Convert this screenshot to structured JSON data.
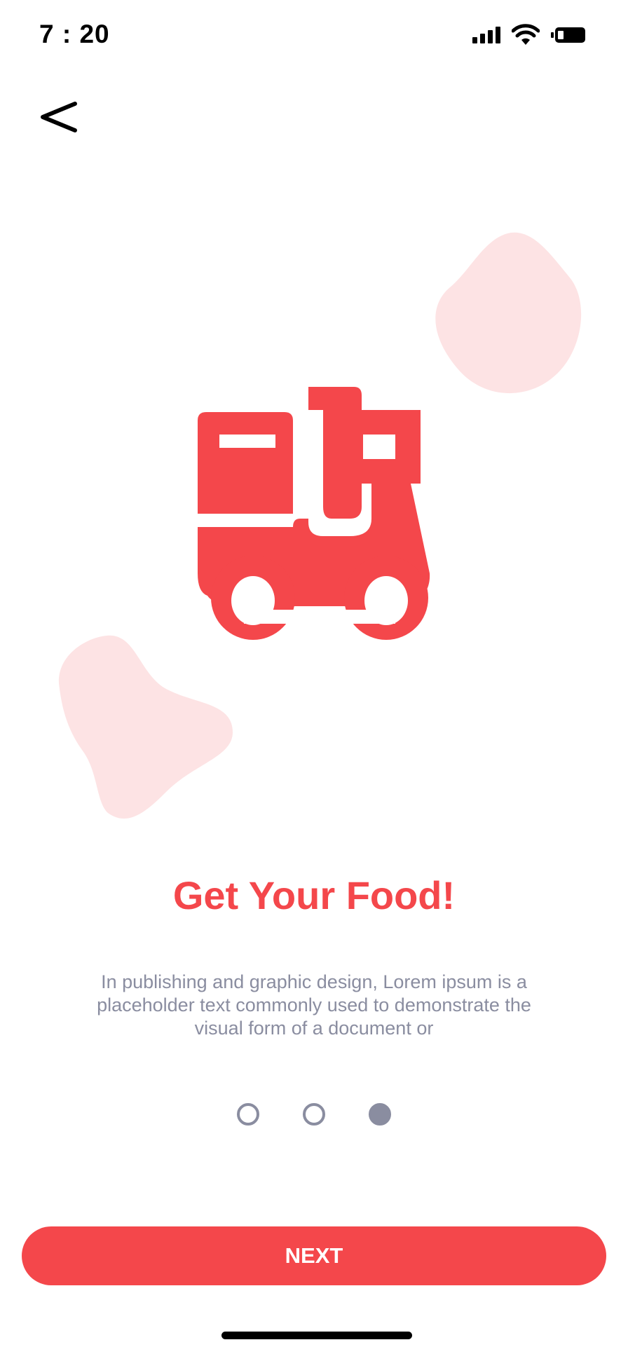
{
  "status_bar": {
    "time": "7 : 20"
  },
  "icons": {
    "back": "chevron-left-icon",
    "signal": "signal-icon",
    "wifi": "wifi-icon",
    "battery": "battery-icon",
    "illustration": "delivery-scooter-icon"
  },
  "onboarding": {
    "title": "Get Your Food!",
    "description": "In publishing and graphic design, Lorem ipsum is a placeholder text commonly used to demonstrate the visual form of a document or",
    "page_count": 3,
    "current_page": 3
  },
  "actions": {
    "next_label": "NEXT"
  },
  "colors": {
    "accent": "#f4474b",
    "blob": "#fde3e4",
    "muted_text": "#8a8da0",
    "indicator": "#8a8da0"
  }
}
